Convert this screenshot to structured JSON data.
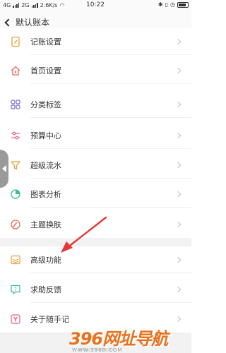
{
  "status_bar": {
    "net1": "4G",
    "net2": "2G",
    "speed": "2.6K/s",
    "time": "10:22"
  },
  "nav": {
    "title": "默认账本"
  },
  "menu": [
    {
      "label": "记账设置",
      "icon": "pencil-book-icon",
      "color": "#e8a23a"
    },
    {
      "label": "首页设置",
      "icon": "home-icon",
      "color": "#e86a5a"
    },
    {
      "label": "分类标签",
      "icon": "grid-icon",
      "color": "#7a6fd8"
    },
    {
      "label": "预算中心",
      "icon": "sliders-icon",
      "color": "#e8607a"
    },
    {
      "label": "超级流水",
      "icon": "filter-icon",
      "color": "#e8a23a"
    },
    {
      "label": "图表分析",
      "icon": "pie-chart-icon",
      "color": "#3cc08a"
    },
    {
      "label": "主题换肤",
      "icon": "palette-icon",
      "color": "#e86a5a"
    },
    {
      "label": "高级功能",
      "icon": "layers-icon",
      "color": "#e8a23a"
    },
    {
      "label": "求助反馈",
      "icon": "help-chat-icon",
      "color": "#3cc08a"
    },
    {
      "label": "关于随手记",
      "icon": "brand-y-icon",
      "color": "#e8607a"
    }
  ],
  "watermark": {
    "text": "396网址导航",
    "subtext": "WWW.396D.COM"
  }
}
